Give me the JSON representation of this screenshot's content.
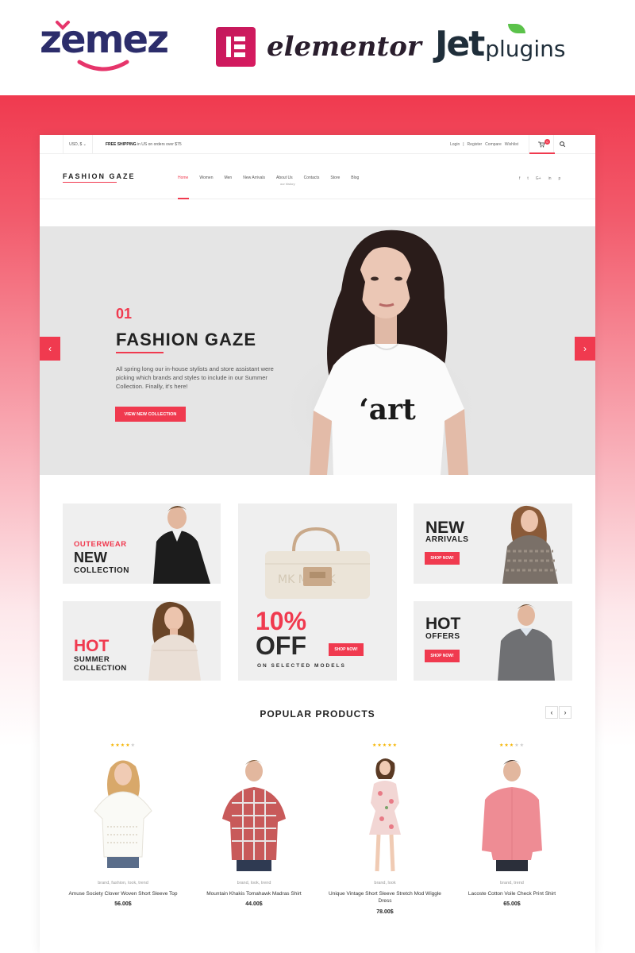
{
  "brands": {
    "zemez": "zemez",
    "elementor": "elementor",
    "jet": "Jet",
    "plugins": "plugins"
  },
  "topbar": {
    "currency": "USD, $ ⌄",
    "shipping_bold": "FREE SHIPPING",
    "shipping_rest": " in US on orders over $75",
    "links": [
      "Login",
      "|",
      "Register",
      "Compare",
      "Wishlist"
    ],
    "cart_count": "0"
  },
  "header": {
    "logo": "FASHION GAZE",
    "nav": [
      "Home",
      "Women",
      "Men",
      "New Arrivals",
      "About Us",
      "Contacts",
      "Store",
      "Blog"
    ],
    "nav_sub": "our history",
    "social": [
      "f",
      "t",
      "G+",
      "in",
      "p"
    ]
  },
  "hero": {
    "number": "01",
    "title": "FASHION GAZE",
    "text": "All spring long our in-house stylists and store assistant were picking which brands and styles to include in our Summer Collection. Finally, it's here!",
    "button": "VIEW NEW COLLECTION",
    "tshirt_text": "‘art",
    "prev": "‹",
    "next": "›"
  },
  "banners": {
    "outerwear": {
      "line1": "OUTERWEAR",
      "line2": "NEW",
      "line3": "COLLECTION"
    },
    "hot_summer": {
      "line1": "HOT",
      "line2": "SUMMER",
      "line3": "COLLECTION"
    },
    "sale": {
      "percent": "10%",
      "off": "OFF",
      "sub": "ON SELECTED MODELS",
      "button": "SHOP NOW!"
    },
    "new_arrivals": {
      "line1": "NEW",
      "line2": "ARRIVALS",
      "button": "SHOP NOW!"
    },
    "hot_offers": {
      "line1": "HOT",
      "line2": "OFFERS",
      "button": "SHOP NOW!"
    }
  },
  "popular": {
    "title": "POPULAR PRODUCTS",
    "prev": "‹",
    "next": "›",
    "products": [
      {
        "rating": 4,
        "tags": "brand, fashion, look, trend",
        "name": "Amuse Society Clover Woven Short Sleeve Top",
        "price": "56.00$"
      },
      {
        "rating": 0,
        "tags": "brand, look, trend",
        "name": "Mountain Khakis Tomahawk Madras Shirt",
        "price": "44.00$"
      },
      {
        "rating": 5,
        "tags": "brand, look",
        "name": "Unique Vintage Short Sleeve Stretch Mod Wiggle Dress",
        "price": "78.00$"
      },
      {
        "rating": 3,
        "tags": "brand, trend",
        "name": "Lacoste Cotton Voile Check Print Shirt",
        "price": "65.00$"
      }
    ]
  },
  "colors": {
    "accent": "#f03a4f",
    "zemez": "#2c2d6b",
    "elementor": "#d81b60",
    "jet_leaf": "#5bc24a"
  }
}
